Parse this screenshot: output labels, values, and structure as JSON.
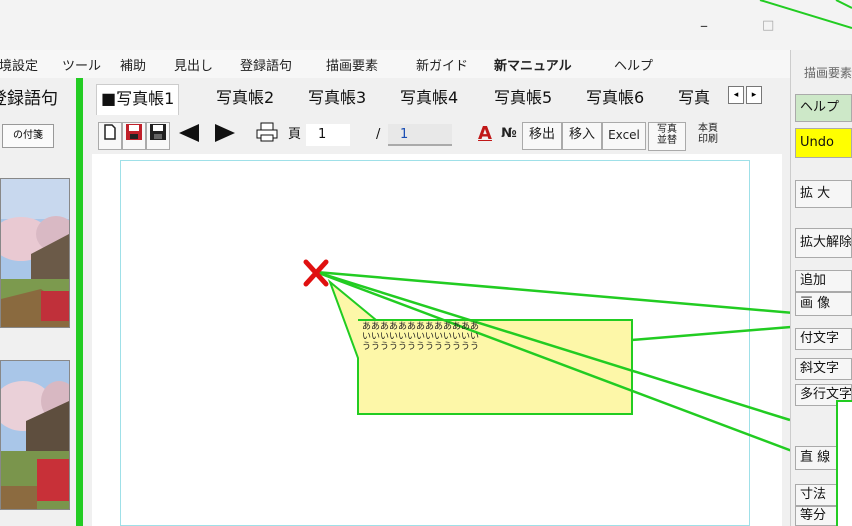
{
  "window": {
    "minimize": "–",
    "maximize": "□",
    "close": "×"
  },
  "menu": [
    {
      "label": "環境設定",
      "bold": false
    },
    {
      "label": "ツール",
      "bold": false
    },
    {
      "label": "補助",
      "bold": false
    },
    {
      "label": "見出し",
      "bold": false
    },
    {
      "label": "登録語句",
      "bold": false
    },
    {
      "label": "描画要素",
      "bold": false
    },
    {
      "label": "新ガイド",
      "bold": false
    },
    {
      "label": "新マニュアル",
      "bold": true
    },
    {
      "label": "ヘルプ",
      "bold": false
    }
  ],
  "left_panel": {
    "title": "登録語句",
    "button": "の付箋"
  },
  "tabs": [
    "■写真帳1",
    "写真帳2",
    "写真帳3",
    "写真帳4",
    "写真帳5",
    "写真帳6",
    "写真"
  ],
  "tab_scroll": {
    "left": "◂",
    "right": "▸"
  },
  "toolbar": {
    "page_label": "頁",
    "page_current": "1",
    "page_sep": "/",
    "page_total": "1",
    "font_btn": "A",
    "number_btn": "№",
    "export_btn": "移出",
    "import_btn": "移入",
    "excel_btn": "Excel",
    "sort_btn": "写真\n並替",
    "print_btn": "本頁\n印刷"
  },
  "callout": {
    "line1": "あああああああああああああ",
    "line2": "いいいいいいいいいいいいい",
    "line3": "ううううううううううううう"
  },
  "right_panel": {
    "header": "描画要素",
    "items": [
      "ヘルプ",
      "Undo",
      "拡 大",
      "拡大解除",
      "追加",
      "画 像",
      "付文字",
      "斜文字",
      "多行文字",
      "直 線",
      "寸法",
      "等分"
    ]
  },
  "colors": {
    "accent_green": "#22cc22",
    "marker_red": "#e01010",
    "callout_fill": "#fdf7a8",
    "undo_yellow": "#ffff00"
  }
}
